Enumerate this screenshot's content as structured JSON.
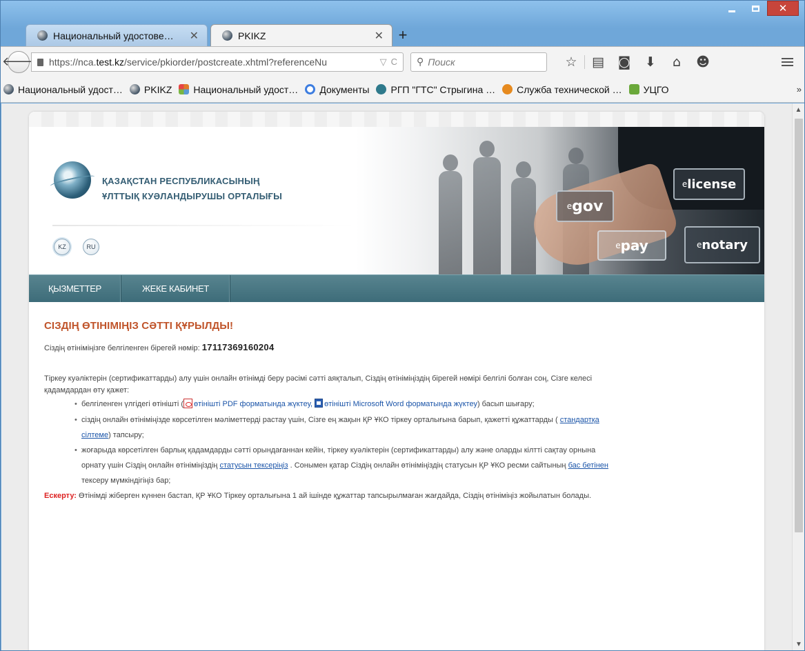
{
  "browser": {
    "tabs": [
      {
        "title": "Национальный удостове…",
        "active": false
      },
      {
        "title": "PKIKZ",
        "active": true
      }
    ],
    "url_prefix": "https://nca.",
    "url_host": "test.kz",
    "url_rest": "/service/pkiorder/postcreate.xhtml?referenceNu",
    "search_placeholder": "Поиск",
    "bookmarks": [
      {
        "label": "Национальный удост…",
        "color": "#4a6b8a"
      },
      {
        "label": "PKIKZ",
        "color": "#4a6b8a"
      },
      {
        "label": "Национальный удост…",
        "color": "#e07b2a"
      },
      {
        "label": "Документы",
        "color": "#3d7de0"
      },
      {
        "label": "РГП \"ГТС\" Стрыгина …",
        "color": "#2f7a8c"
      },
      {
        "label": "Служба технической …",
        "color": "#e68a1f"
      },
      {
        "label": "УЦГО",
        "color": "#6aa83a"
      }
    ],
    "more_bookmarks": "»"
  },
  "site": {
    "org_line1": "ҚАЗАҚСТАН РЕСПУБЛИКАСЫНЫҢ",
    "org_line2": "ҰЛТТЫҚ КУӘЛАНДЫРУШЫ ОРТАЛЫҒЫ",
    "lang_kz": "KZ",
    "lang_ru": "RU",
    "banner_tiles": {
      "egov_prefix": "e",
      "egov": "gov",
      "elicense_prefix": "e",
      "elicense": "license",
      "epay_prefix": "e",
      "epay": "pay",
      "enotary_prefix": "e",
      "enotary": "notary"
    },
    "menu": [
      "ҚЫЗМЕТТЕР",
      "ЖЕКЕ КАБИНЕТ"
    ]
  },
  "content": {
    "title": "СІЗДІҢ ӨТІНІМІҢІЗ СӘТТІ ҚҰРЫЛДЫ!",
    "ref_label": "Сіздің өтініміңізге белгіленген бірегей нөмір:",
    "ref_number": "17117369160204",
    "intro_line1": "Тіркеу куәліктерін (сертификаттарды) алу үшін онлайн өтінімді беру рәсімі сәтті аяқталып, Сіздің өтініміңіздің бірегей нөмірі белгілі болған соң, Сізге келесі",
    "intro_line2": "қадамдардан өту қажет:",
    "step1_pre": "белгіленген үлгідегі өтінішті (",
    "step1_pdf": "өтінішті PDF форматында жүктеу,",
    "step1_word": "өтінішті Microsoft Word форматында жүктеу",
    "step1_post": ") басып шығару;",
    "step2_pre": "сіздің онлайн өтініміңізде көрсетілген мәліметтерді растау үшін, Сізге ең жақын ҚР ҰКО тіркеу орталығына барып, қажетті құжаттарды (",
    "step2_link_a": "стандартқа",
    "step2_link_b": "сілтеме",
    "step2_post": ") тапсыру;",
    "step3_line1": "жоғарыда көрсетілген барлық қадамдарды сәтті орындағаннан кейін, тіркеу куәліктерін (сертификаттарды) алу және оларды кілтті сақтау орнына",
    "step3_pre": "орнату үшін Сіздің онлайн өтініміңіздің",
    "step3_link1": "статусын тексеріңіз",
    "step3_mid": ". Сонымен қатар Сіздің онлайн өтініміңіздің статусын ҚР ҰКО ресми сайтының",
    "step3_link2": "бас бетінен",
    "step3_line3": "тексеру мүмкіндігіңіз бар;",
    "warning_label": "Ескерту:",
    "warning_text": "Өтінімді жіберген күннен бастап, ҚР ҰКО Тіркеу орталығына 1 ай ішінде құжаттар тапсырылмаған жағдайда, Сіздің өтініміңіз жойылатын болады."
  }
}
